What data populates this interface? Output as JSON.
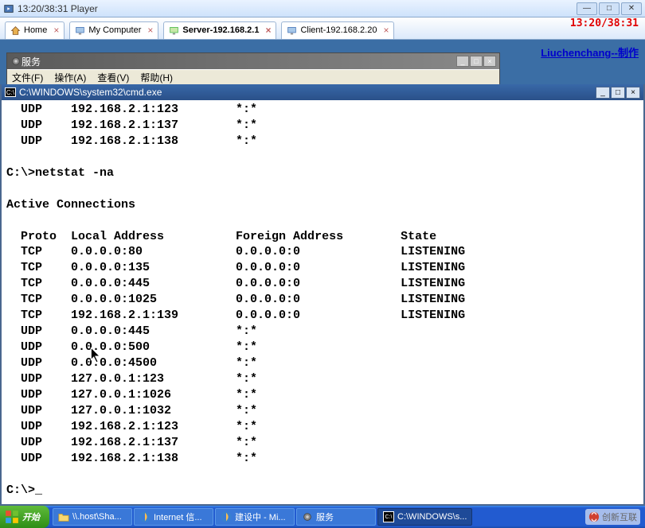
{
  "window": {
    "title": "13:20/38:31 Player",
    "corner_time": "13:20/38:31",
    "signature": "Liuchenchang--制作"
  },
  "tabs": [
    {
      "label": "Home",
      "icon": "home"
    },
    {
      "label": "My Computer",
      "icon": "computer"
    },
    {
      "label": "Server-192.168.2.1",
      "icon": "server"
    },
    {
      "label": "Client-192.168.2.20",
      "icon": "client"
    }
  ],
  "services": {
    "title": "服务",
    "menu": [
      "文件(F)",
      "操作(A)",
      "查看(V)",
      "帮助(H)"
    ]
  },
  "cmd": {
    "title": "C:\\WINDOWS\\system32\\cmd.exe",
    "lines": [
      "  UDP    192.168.2.1:123        *:*",
      "  UDP    192.168.2.1:137        *:*",
      "  UDP    192.168.2.1:138        *:*",
      "",
      "C:\\>netstat -na",
      "",
      "Active Connections",
      "",
      "  Proto  Local Address          Foreign Address        State",
      "  TCP    0.0.0.0:80             0.0.0.0:0              LISTENING",
      "  TCP    0.0.0.0:135            0.0.0.0:0              LISTENING",
      "  TCP    0.0.0.0:445            0.0.0.0:0              LISTENING",
      "  TCP    0.0.0.0:1025           0.0.0.0:0              LISTENING",
      "  TCP    192.168.2.1:139        0.0.0.0:0              LISTENING",
      "  UDP    0.0.0.0:445            *:*",
      "  UDP    0.0.0.0:500            *:*",
      "  UDP    0.0.0.0:4500           *:*",
      "  UDP    127.0.0.1:123          *:*",
      "  UDP    127.0.0.1:1026         *:*",
      "  UDP    127.0.0.1:1032         *:*",
      "  UDP    192.168.2.1:123        *:*",
      "  UDP    192.168.2.1:137        *:*",
      "  UDP    192.168.2.1:138        *:*",
      "",
      "C:\\>_"
    ]
  },
  "taskbar": {
    "start": "开始",
    "buttons": [
      {
        "label": "\\\\.host\\Sha..."
      },
      {
        "label": "Internet 信..."
      },
      {
        "label": "建设中 - Mi..."
      },
      {
        "label": "服务"
      },
      {
        "label": "C:\\WINDOWS\\s..."
      }
    ]
  },
  "watermark": "创新互联"
}
